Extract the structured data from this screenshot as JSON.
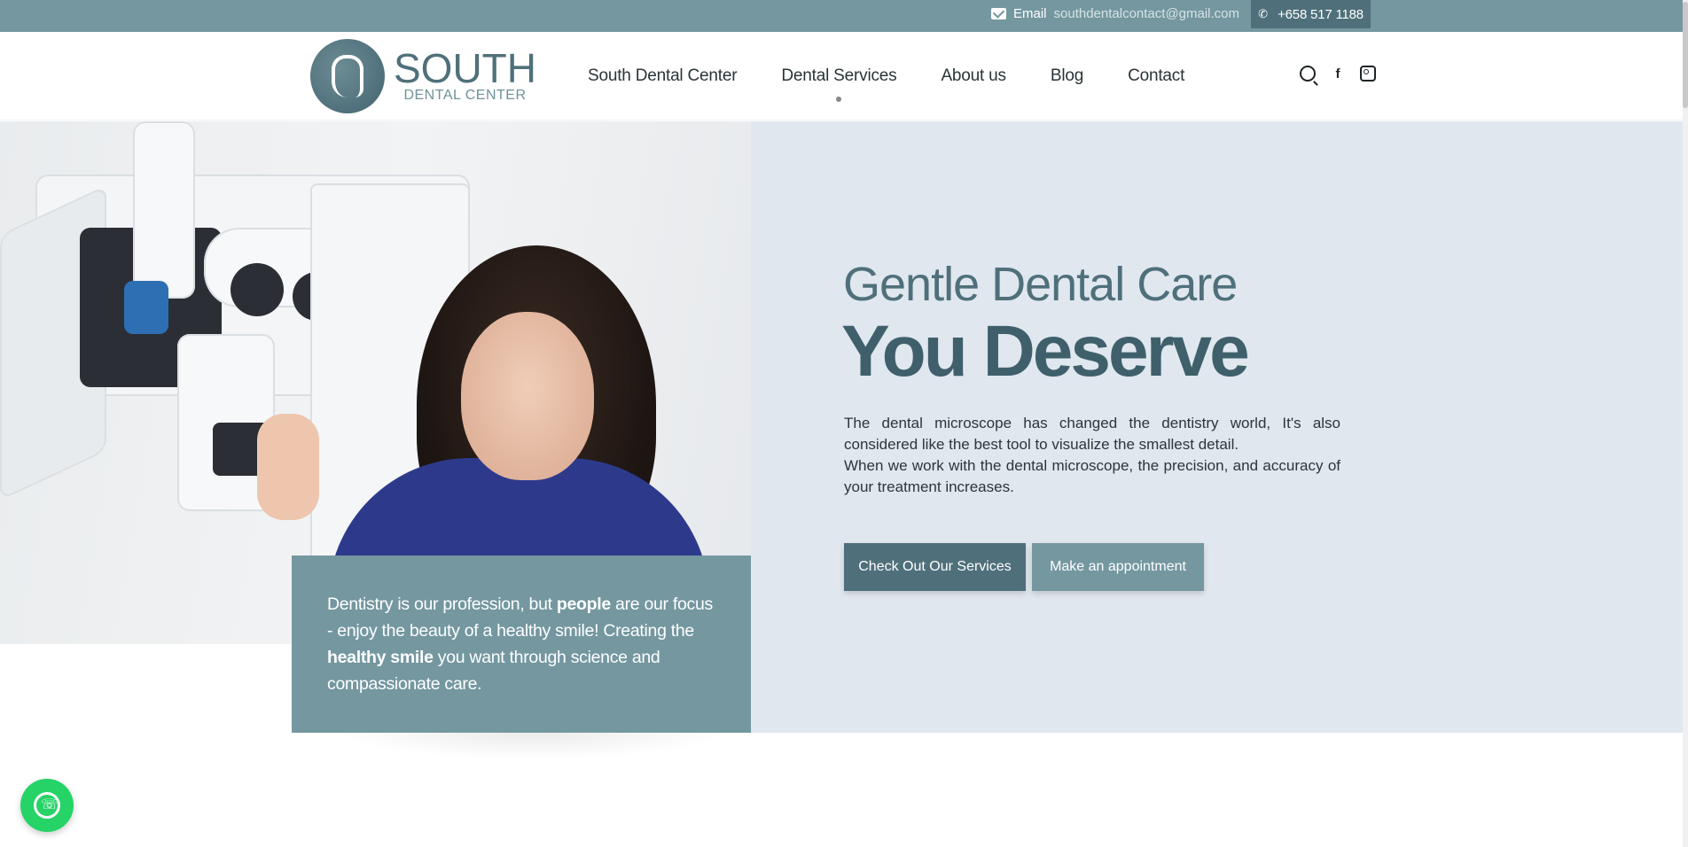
{
  "topbar": {
    "email_label": "Email",
    "email_address": "southdentalcontact@gmail.com",
    "phone": "+658 517 1188",
    "email_icon": "envelope-icon",
    "phone_icon": "phone-icon"
  },
  "header": {
    "logo_title": "SOUTH",
    "logo_subtitle": "DENTAL CENTER",
    "nav": [
      {
        "label": "South Dental Center"
      },
      {
        "label": "Dental Services"
      },
      {
        "label": "About us"
      },
      {
        "label": "Blog"
      },
      {
        "label": "Contact"
      }
    ],
    "icons": [
      "search-icon",
      "facebook-icon",
      "instagram-icon"
    ]
  },
  "hero": {
    "heading_line1": "Gentle Dental Care",
    "heading_line2": "You Deserve",
    "paragraph1": "The dental microscope has changed the dentistry world, It's also considered like the best tool to visualize the smallest detail.",
    "paragraph2": "When we work with the dental microscope, the precision, and accuracy of your treatment increases.",
    "button_services": "Check Out Our Services",
    "button_appointment": "Make an appointment"
  },
  "quote": {
    "t1": "Dentistry is our profession, but ",
    "b1": "people",
    "t2": " are our focus - enjoy the beauty of a healthy smile! Creating the ",
    "b2": "healthy smile",
    "t3": " you want through science and compassionate care."
  },
  "colors": {
    "primary": "#4f707b",
    "secondary": "#7497a0",
    "hero_bg": "#e0e7ef",
    "whatsapp": "#25d366"
  }
}
